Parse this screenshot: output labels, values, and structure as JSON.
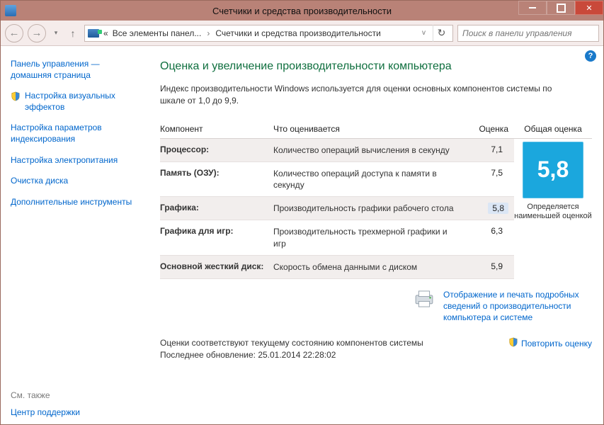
{
  "window": {
    "title": "Счетчики и средства производительности"
  },
  "breadcrumb": {
    "root": "Все элементы панел...",
    "current": "Счетчики и средства производительности"
  },
  "search": {
    "placeholder": "Поиск в панели управления"
  },
  "sidebar": {
    "home1": "Панель управления —",
    "home2": "домашняя страница",
    "links": [
      "Настройка визуальных эффектов",
      "Настройка параметров индексирования",
      "Настройка электропитания",
      "Очистка диска",
      "Дополнительные инструменты"
    ],
    "see_also": "См. также",
    "support": "Центр поддержки"
  },
  "main": {
    "heading": "Оценка и увеличение производительности компьютера",
    "intro": "Индекс производительности Windows используется для оценки основных компонентов системы по шкале от 1,0 до 9,9.",
    "headers": {
      "component": "Компонент",
      "what": "Что оценивается",
      "score": "Оценка",
      "base": "Общая оценка"
    },
    "rows": [
      {
        "name": "Процессор:",
        "desc": "Количество операций вычисления в секунду",
        "score": "7,1"
      },
      {
        "name": "Память (ОЗУ):",
        "desc": "Количество операций доступа к памяти в секунду",
        "score": "7,5"
      },
      {
        "name": "Графика:",
        "desc": "Производительность графики рабочего стола",
        "score": "5,8",
        "lowest": true
      },
      {
        "name": "Графика для игр:",
        "desc": "Производительность трехмерной графики и игр",
        "score": "6,3"
      },
      {
        "name": "Основной жесткий диск:",
        "desc": "Скорость обмена данными с диском",
        "score": "5,9"
      }
    ],
    "base_score": "5,8",
    "base_caption": "Определяется наименьшей оценкой",
    "details_link": "Отображение и печать подробных сведений о производительности компьютера и системе",
    "status1": "Оценки соответствуют текущему состоянию компонентов системы",
    "status2": "Последнее обновление: 25.01.2014 22:28:02",
    "rerun": "Повторить оценку"
  },
  "chart_data": {
    "type": "table",
    "title": "Индекс производительности Windows",
    "scale": [
      1.0,
      9.9
    ],
    "columns": [
      "Компонент",
      "Что оценивается",
      "Оценка"
    ],
    "rows": [
      [
        "Процессор",
        "Количество операций вычисления в секунду",
        7.1
      ],
      [
        "Память (ОЗУ)",
        "Количество операций доступа к памяти в секунду",
        7.5
      ],
      [
        "Графика",
        "Производительность графики рабочего стола",
        5.8
      ],
      [
        "Графика для игр",
        "Производительность трехмерной графики и игр",
        6.3
      ],
      [
        "Основной жесткий диск",
        "Скорость обмена данными с диском",
        5.9
      ]
    ],
    "base_score": 5.8,
    "base_rule": "minimum of component scores"
  }
}
